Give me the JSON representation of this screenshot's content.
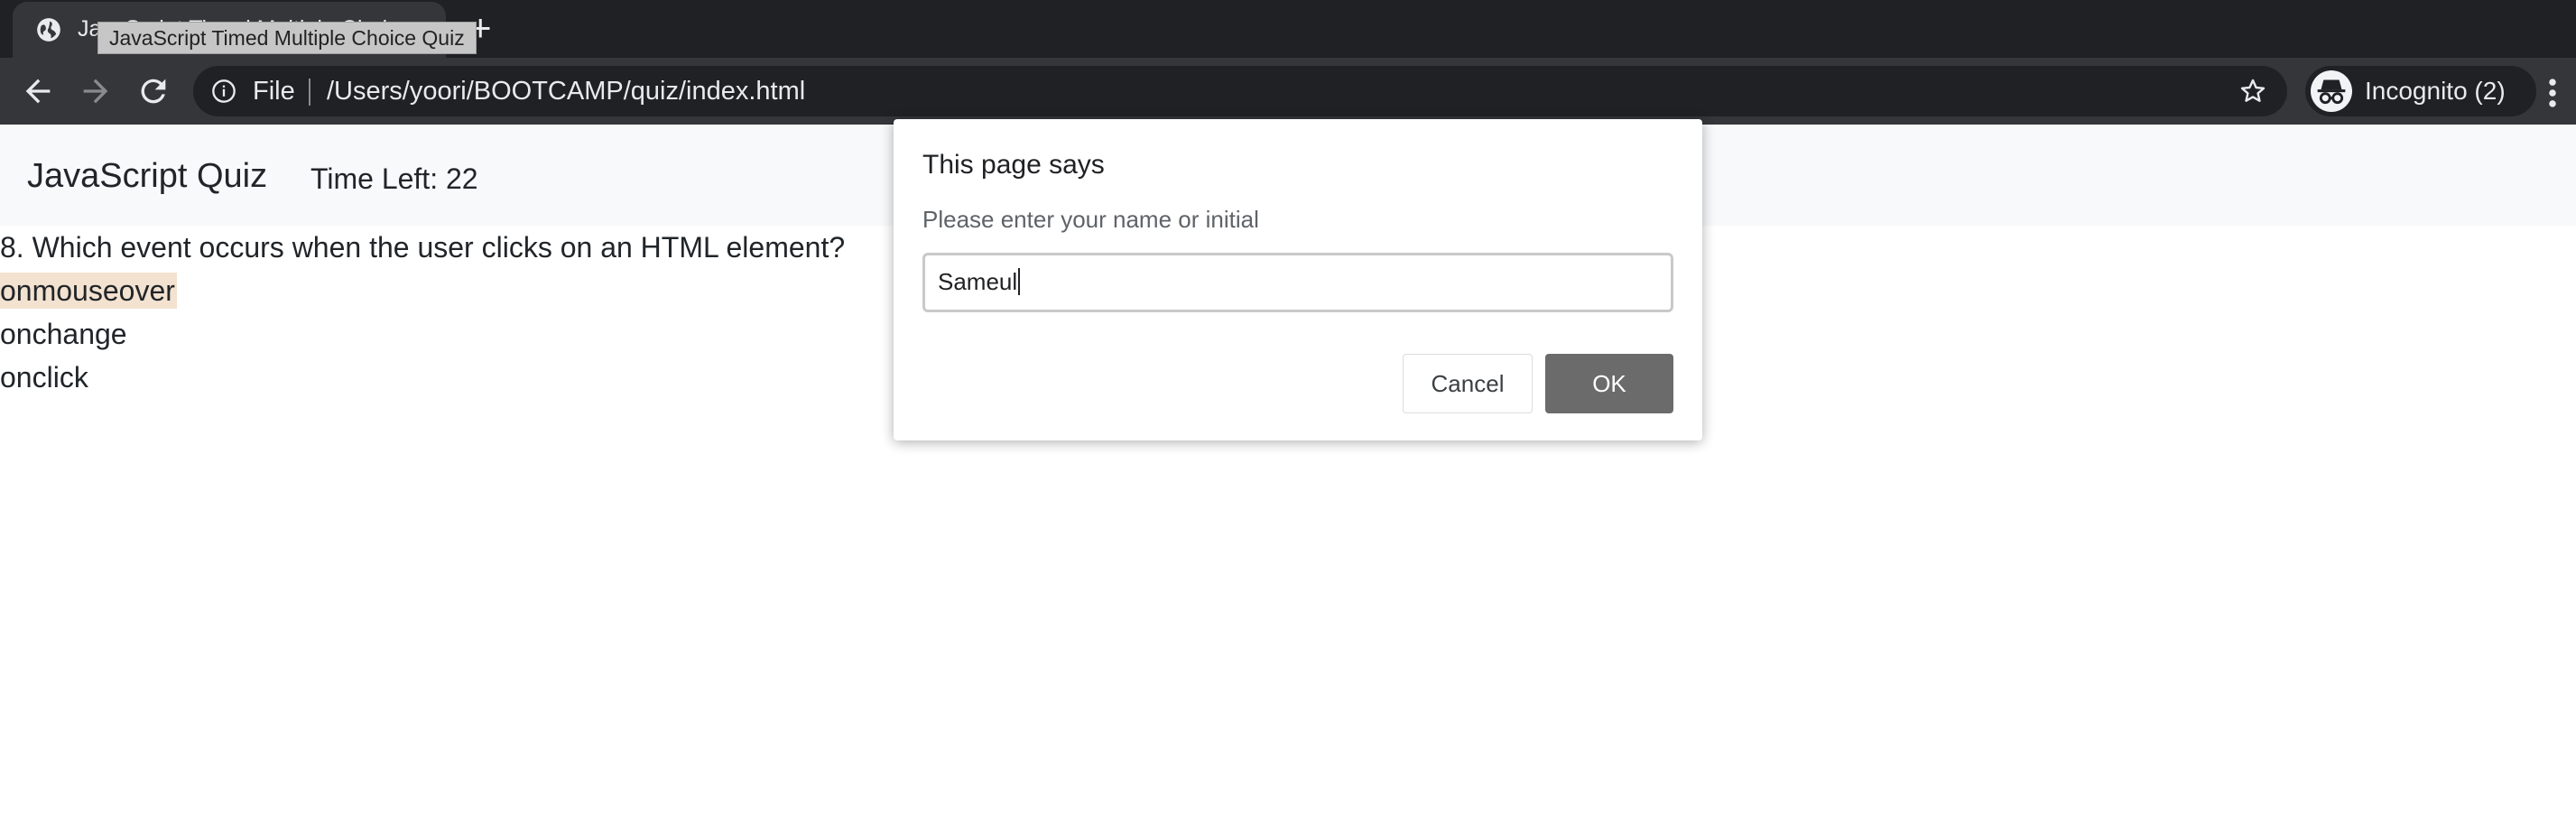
{
  "browser": {
    "tab_title": "JavaScript Timed Multiple Choice Quiz",
    "tooltip": "JavaScript Timed Multiple Choice Quiz",
    "new_tab_symbol": "+",
    "omnibox": {
      "scheme_label": "File",
      "url": "/Users/yoori/BOOTCAMP/quiz/index.html"
    },
    "profile_label": "Incognito (2)",
    "icons": [
      "globe-icon",
      "back-icon",
      "forward-icon",
      "reload-icon",
      "info-icon",
      "star-icon",
      "incognito-icon",
      "menu-icon"
    ]
  },
  "page": {
    "brand": "JavaScript Quiz",
    "timer": "Time Left: 22",
    "question": "8. Which event occurs when the user clicks on an HTML element?",
    "choices": [
      "onmouseover",
      "onchange",
      "onclick"
    ],
    "highlighted_choice": "onmouseover",
    "highlight_color": "#f3e2d0"
  },
  "dialog": {
    "title": "This page says",
    "message": "Please enter your name or initial",
    "input_value": "Sameul",
    "cancel_label": "Cancel",
    "ok_label": "OK"
  }
}
